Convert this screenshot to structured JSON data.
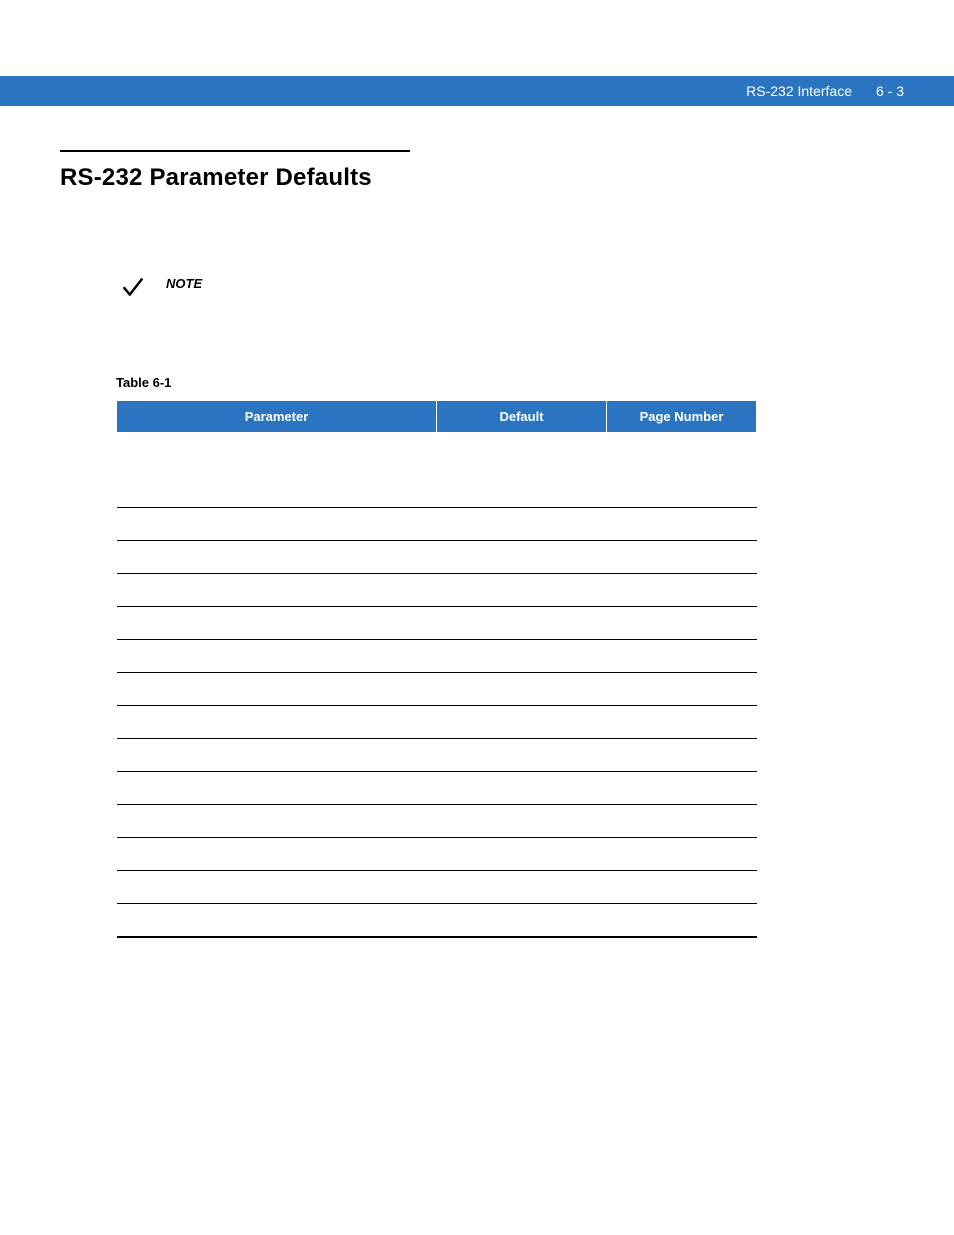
{
  "header": {
    "chapter_title": "RS-232 Interface",
    "page_label": "6 - 3"
  },
  "section": {
    "title": "RS-232 Parameter Defaults"
  },
  "note": {
    "label": "NOTE"
  },
  "table": {
    "caption": "Table 6-1",
    "headers": {
      "col1": "Parameter",
      "col2": "Default",
      "col3": "Page Number"
    },
    "rows": [
      {
        "parameter": "",
        "default": "",
        "page": ""
      },
      {
        "parameter": "",
        "default": "",
        "page": ""
      },
      {
        "parameter": "",
        "default": "",
        "page": ""
      },
      {
        "parameter": "",
        "default": "",
        "page": ""
      },
      {
        "parameter": "",
        "default": "",
        "page": ""
      },
      {
        "parameter": "",
        "default": "",
        "page": ""
      },
      {
        "parameter": "",
        "default": "",
        "page": ""
      },
      {
        "parameter": "",
        "default": "",
        "page": ""
      },
      {
        "parameter": "",
        "default": "",
        "page": ""
      },
      {
        "parameter": "",
        "default": "",
        "page": ""
      },
      {
        "parameter": "",
        "default": "",
        "page": ""
      },
      {
        "parameter": "",
        "default": "",
        "page": ""
      },
      {
        "parameter": "",
        "default": "",
        "page": ""
      },
      {
        "parameter": "",
        "default": "",
        "page": ""
      },
      {
        "parameter": "",
        "default": "",
        "page": ""
      }
    ]
  }
}
